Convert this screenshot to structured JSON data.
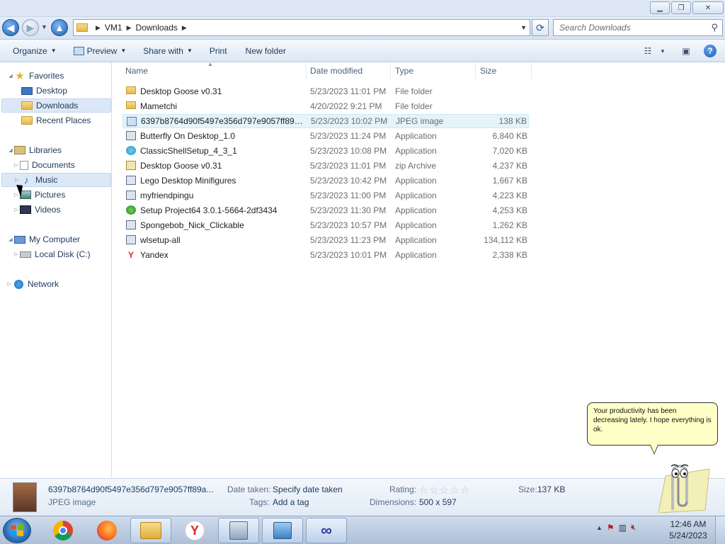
{
  "address": {
    "segments": [
      "VM1",
      "Downloads"
    ],
    "search_placeholder": "Search Downloads"
  },
  "toolbar": {
    "organize": "Organize",
    "preview": "Preview",
    "share_with": "Share with",
    "print": "Print",
    "new_folder": "New folder"
  },
  "nav": {
    "favorites": "Favorites",
    "desktop": "Desktop",
    "downloads": "Downloads",
    "recent_places": "Recent Places",
    "libraries": "Libraries",
    "documents": "Documents",
    "music": "Music",
    "pictures": "Pictures",
    "videos": "Videos",
    "my_computer": "My Computer",
    "local_disk": "Local Disk (C:)",
    "network": "Network"
  },
  "columns": {
    "name": "Name",
    "date": "Date modified",
    "type": "Type",
    "size": "Size"
  },
  "files": [
    {
      "name": "Desktop Goose v0.31",
      "date": "5/23/2023 11:01 PM",
      "type": "File folder",
      "size": "",
      "icon": "folder-icon"
    },
    {
      "name": "Mametchi",
      "date": "4/20/2022 9:21 PM",
      "type": "File folder",
      "size": "",
      "icon": "folder-icon"
    },
    {
      "name": "6397b8764d90f5497e356d797e9057ff89af6...",
      "date": "5/23/2023 10:02 PM",
      "type": "JPEG image",
      "size": "138 KB",
      "icon": "image-icon"
    },
    {
      "name": "Butterfly On Desktop_1.0",
      "date": "5/23/2023 11:24 PM",
      "type": "Application",
      "size": "6,840 KB",
      "icon": "application-icon"
    },
    {
      "name": "ClassicShellSetup_4_3_1",
      "date": "5/23/2023 10:08 PM",
      "type": "Application",
      "size": "7,020 KB",
      "icon": "shell-icon"
    },
    {
      "name": "Desktop Goose v0.31",
      "date": "5/23/2023 11:01 PM",
      "type": "zip Archive",
      "size": "4,237 KB",
      "icon": "zip-icon"
    },
    {
      "name": "Lego Desktop Minifigures",
      "date": "5/23/2023 10:42 PM",
      "type": "Application",
      "size": "1,667 KB",
      "icon": "application-icon"
    },
    {
      "name": "myfriendpingu",
      "date": "5/23/2023 11:00 PM",
      "type": "Application",
      "size": "4,223 KB",
      "icon": "application-icon"
    },
    {
      "name": "Setup Project64 3.0.1-5664-2df3434",
      "date": "5/23/2023 11:30 PM",
      "type": "Application",
      "size": "4,253 KB",
      "icon": "setup-icon"
    },
    {
      "name": "Spongebob_Nick_Clickable",
      "date": "5/23/2023 10:57 PM",
      "type": "Application",
      "size": "1,262 KB",
      "icon": "application-icon"
    },
    {
      "name": "wlsetup-all",
      "date": "5/23/2023 11:23 PM",
      "type": "Application",
      "size": "134,112 KB",
      "icon": "application-icon"
    },
    {
      "name": "Yandex",
      "date": "5/23/2023 10:01 PM",
      "type": "Application",
      "size": "2,338 KB",
      "icon": "yandex-icon"
    }
  ],
  "details": {
    "filename": "6397b8764d90f5497e356d797e9057ff89a...",
    "filetype": "JPEG image",
    "date_taken_label": "Date taken:",
    "date_taken_value": "Specify date taken",
    "tags_label": "Tags:",
    "tags_value": "Add a tag",
    "rating_label": "Rating:",
    "rating_stars": 0,
    "dimensions_label": "Dimensions:",
    "dimensions_value": "500 x 597",
    "size_label": "Size:",
    "size_value": "137 KB"
  },
  "clippy": {
    "message": "Your productivity has been decreasing lately. I hope everything is ok."
  },
  "taskbar": {
    "time": "12:46 AM",
    "date": "5/24/2023"
  }
}
